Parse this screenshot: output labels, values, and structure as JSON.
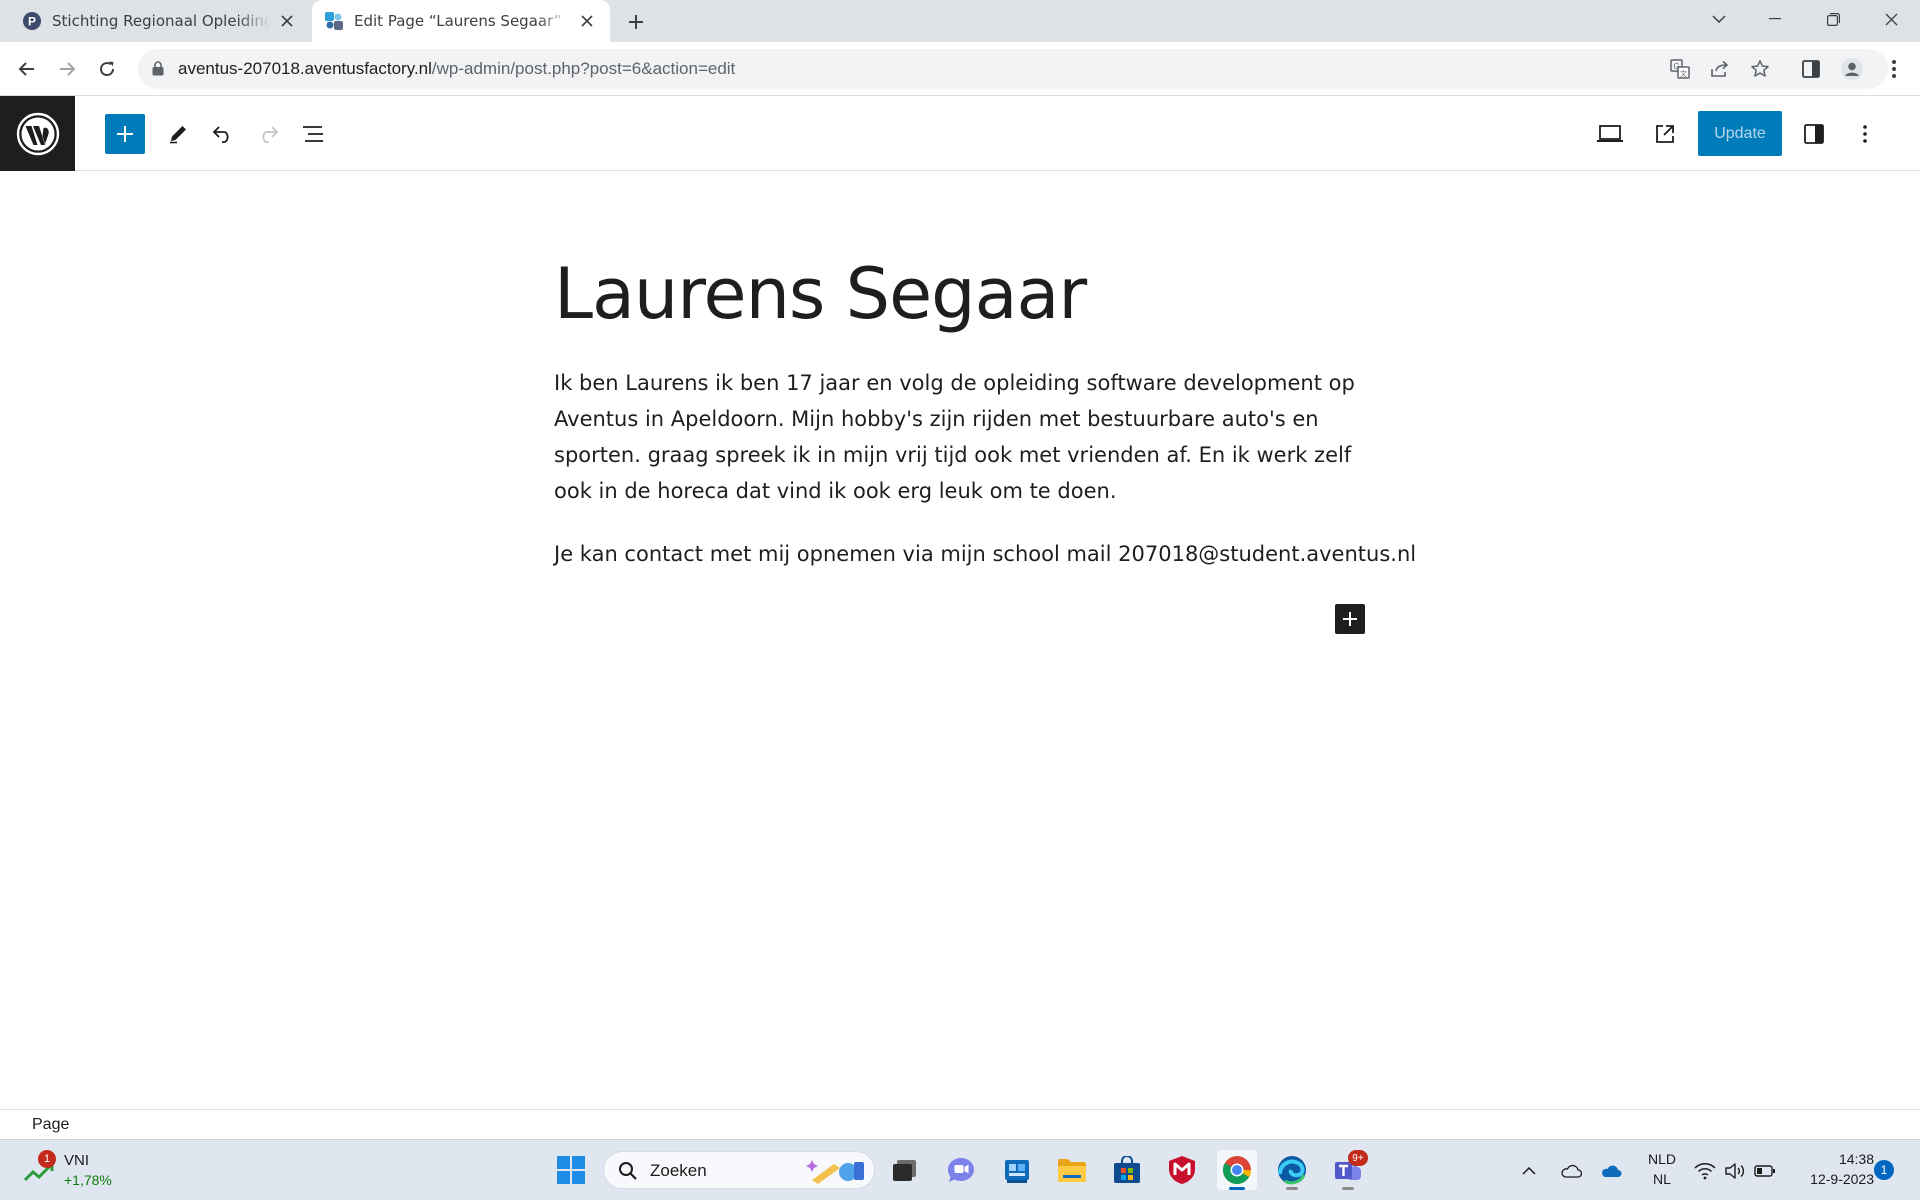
{
  "browser": {
    "tabs": [
      {
        "title": "Stichting Regionaal Opleidingen C",
        "favicon": "pluizer-p-icon",
        "active": false
      },
      {
        "title": "Edit Page “Laurens Segaar” ‹ Pluiz",
        "favicon": "wp-admin-icon",
        "active": true
      }
    ],
    "address": {
      "host": "aventus-207018.aventusfactory.nl",
      "path": "/wp-admin/post.php?post=6&action=edit"
    }
  },
  "editor": {
    "update_label": "Update",
    "post_title": "Laurens Segaar",
    "paragraphs": [
      "Ik ben Laurens ik ben 17 jaar en volg de opleiding software development op Aventus in Apeldoorn. Mijn hobby's zijn rijden met bestuurbare auto's en sporten. graag spreek ik in mijn vrij tijd ook met vrienden af. En ik werk zelf ook in de horeca dat vind ik ook erg leuk om te doen.",
      "Je kan contact met mij opnemen via mijn school mail 207018@student.aventus.nl"
    ],
    "breadcrumb": "Page",
    "colors": {
      "accent": "#007cba",
      "dark": "#1e1e1e"
    }
  },
  "taskbar": {
    "stock": {
      "name": "VNI",
      "change": "+1,78%",
      "badge": "1"
    },
    "search_placeholder": "Zoeken",
    "teams_badge": "9+",
    "language": {
      "line1": "NLD",
      "line2": "NL"
    },
    "time": "14:38",
    "date": "12-9-2023",
    "notifications": "1"
  }
}
